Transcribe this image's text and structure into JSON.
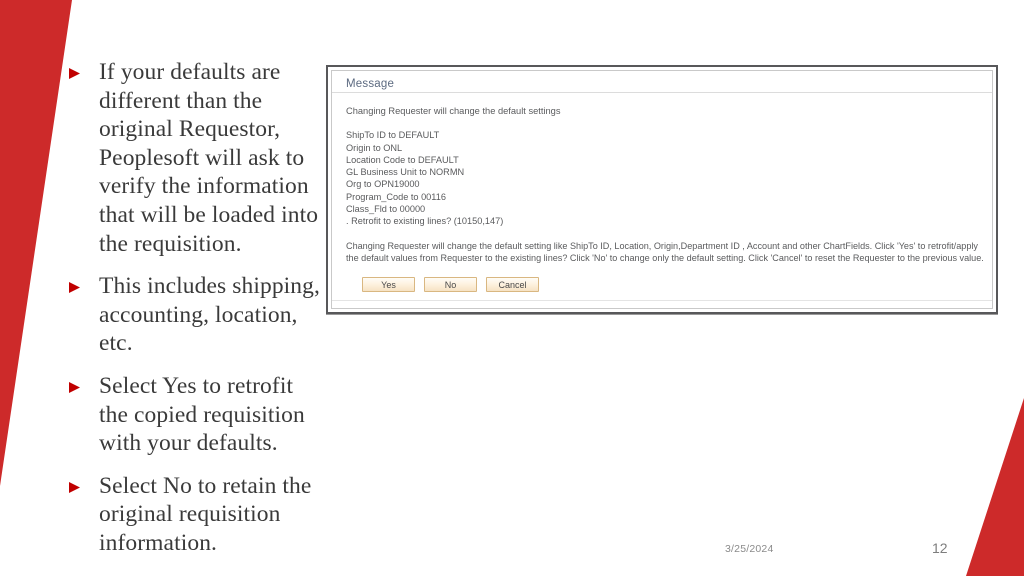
{
  "theme": {
    "accent_red": "#CD2A2A",
    "body_text": "#3a3a3a",
    "dialog_text": "#5a5b5d",
    "dialog_title_color": "#5c6a80",
    "button_face": "#fdf0dc"
  },
  "slide": {
    "bullets": [
      {
        "marker": "triangle-bullet-icon",
        "text": "If your defaults are different than the original Requestor, Peoplesoft will ask to verify the information that will be loaded into the requisition."
      },
      {
        "marker": "triangle-bullet-icon",
        "text": "This includes shipping, accounting, location, etc."
      },
      {
        "marker": "triangle-bullet-icon",
        "text": "Select Yes to retrofit the copied requisition with your defaults."
      },
      {
        "marker": "triangle-bullet-icon",
        "text": "Select No to retain the original requisition information."
      }
    ]
  },
  "dialog": {
    "title": "Message",
    "intro": "Changing Requester will change the default settings",
    "details": [
      "ShipTo ID to DEFAULT",
      "Origin to ONL",
      "Location Code  to DEFAULT",
      "GL Business Unit  to NORMN",
      "Org  to OPN19000",
      "Program_Code  to 00116",
      "Class_Fld  to 00000",
      ". Retrofit to existing lines? (10150,147)"
    ],
    "long_text": "Changing Requester will change the default setting like ShipTo ID, Location, Origin,Department ID , Account and other ChartFields.  Click 'Yes' to retrofit/apply  the default values from Requester to the existing lines? Click 'No' to change only the default setting. Click 'Cancel' to reset the Requester to the previous value.",
    "buttons": [
      {
        "label": "Yes"
      },
      {
        "label": "No"
      },
      {
        "label": "Cancel"
      }
    ]
  },
  "footer": {
    "date": "3/25/2024",
    "page_number": "12"
  }
}
